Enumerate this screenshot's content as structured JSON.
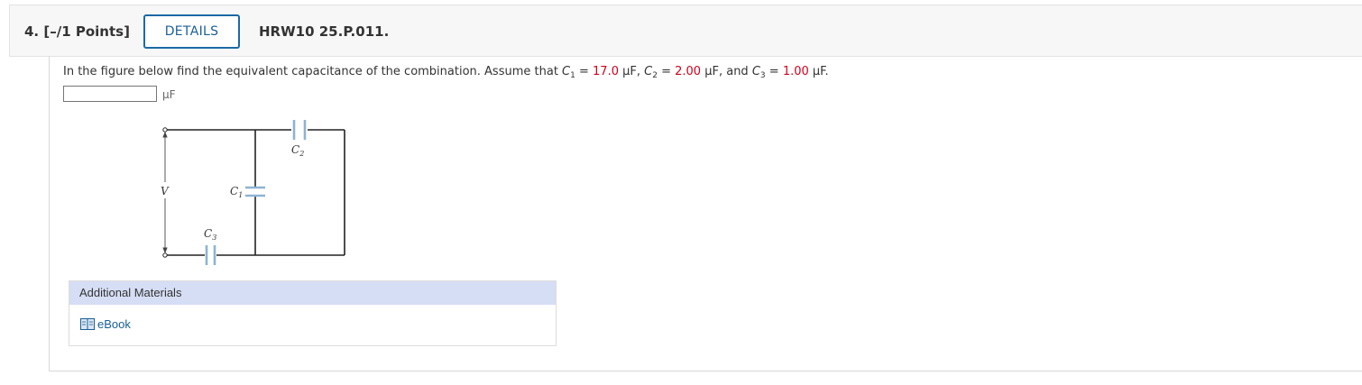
{
  "question": {
    "number_label": "4.  [–/1 Points]",
    "details_label": "DETAILS",
    "id_label": "HRW10 25.P.011."
  },
  "prompt": {
    "text_before": "In the figure below find the equivalent capacitance of the combination. Assume that ",
    "c1_var": "C",
    "c1_sub": "1",
    "c1_eq": " = ",
    "c1_value": "17.0",
    "c1_unit": " μF, ",
    "c2_var": "C",
    "c2_sub": "2",
    "c2_eq": " = ",
    "c2_value": "2.00",
    "c2_unit": " μF, and ",
    "c3_var": "C",
    "c3_sub": "3",
    "c3_eq": " = ",
    "c3_value": "1.00",
    "c3_unit": " μF."
  },
  "answer": {
    "value": "",
    "unit": "μF"
  },
  "figure": {
    "label_c2": "C",
    "label_c2_sub": "2",
    "label_c1": "C",
    "label_c1_sub": "1",
    "label_c3": "C",
    "label_c3_sub": "3",
    "label_v": "V",
    "plate_color": "#8fb3d1",
    "wire_color": "#222222"
  },
  "additional_materials": {
    "header": "Additional Materials",
    "ebook_label": "eBook",
    "ebook_icon": "book-icon"
  },
  "colors": {
    "given_value": "#d0021b",
    "link": "#1a5f96",
    "details_border": "#1a6aa6",
    "materials_header_bg": "#d6def5"
  }
}
